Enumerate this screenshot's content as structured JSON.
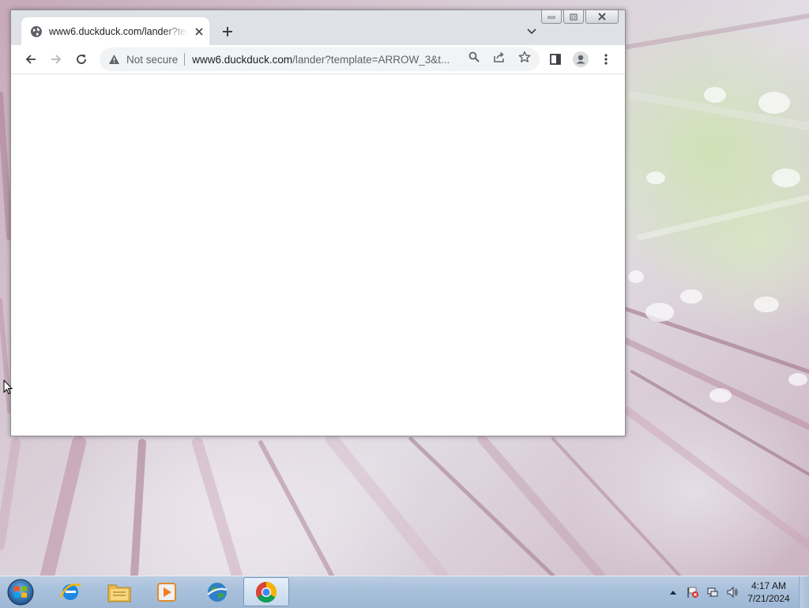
{
  "browser": {
    "tab": {
      "title": "www6.duckduck.com/lander?template=ARROW_3&t",
      "favicon": "globe-icon"
    },
    "toolbar": {
      "security_label": "Not secure",
      "url_host": "www6.duckduck.com",
      "url_path": "/lander?template=ARROW_3&t..."
    }
  },
  "taskbar": {
    "items": [
      {
        "name": "internet-explorer",
        "icon": "ie-icon"
      },
      {
        "name": "windows-explorer",
        "icon": "folder-icon"
      },
      {
        "name": "media-player",
        "icon": "media-player-icon"
      },
      {
        "name": "globe-app",
        "icon": "globe-app-icon"
      },
      {
        "name": "google-chrome",
        "icon": "chrome-icon",
        "active": true
      }
    ],
    "clock": {
      "time": "4:17 AM",
      "date": "7/21/2024"
    }
  },
  "colors": {
    "tabstrip": "#dee1e6",
    "omnibox": "#f1f3f4",
    "taskbar": "#a8c0db"
  }
}
